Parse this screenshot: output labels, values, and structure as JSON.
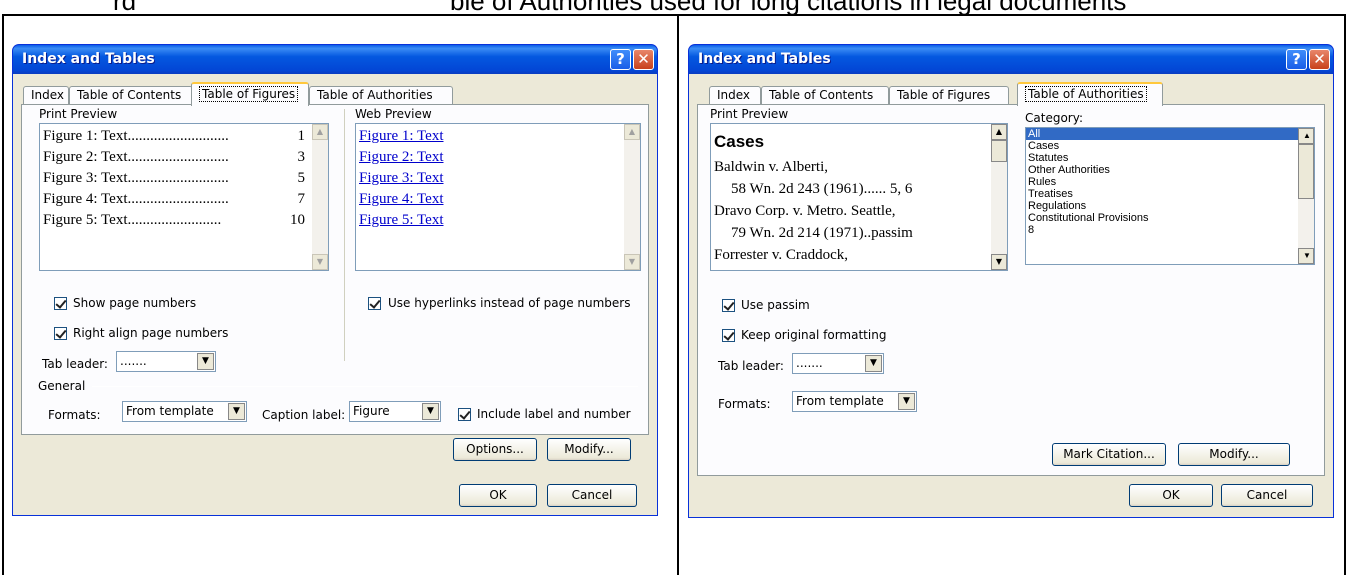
{
  "top_caption": [
    "rd",
    "ble of Authorities used for long citations in legal documents"
  ],
  "left_dialog": {
    "title": "Index and Tables",
    "help_glyph": "?",
    "close_glyph": "✕",
    "tabs": [
      "Index",
      "Table of Contents",
      "Table of Figures",
      "Table of Authorities"
    ],
    "active_tab": "Table of Figures",
    "print_preview_label": "Print Preview",
    "print_preview_rows": [
      {
        "text": "Figure 1: Text",
        "dots": "...........................",
        "page": "1"
      },
      {
        "text": "Figure 2: Text",
        "dots": "...........................",
        "page": "3"
      },
      {
        "text": "Figure 3: Text",
        "dots": "...........................",
        "page": "5"
      },
      {
        "text": "Figure 4: Text",
        "dots": "...........................",
        "page": "7"
      },
      {
        "text": "Figure 5: Text",
        "dots": ".........................",
        "page": "10"
      }
    ],
    "web_preview_label": "Web Preview",
    "web_preview_links": [
      "Figure 1: Text",
      "Figure 2: Text",
      "Figure 3: Text",
      "Figure 4: Text",
      "Figure 5: Text"
    ],
    "show_page_numbers": "Show page numbers",
    "right_align": "Right align page numbers",
    "use_hyperlinks": "Use hyperlinks instead of page numbers",
    "tab_leader_label": "Tab leader:",
    "tab_leader_value": ".......",
    "general_label": "General",
    "formats_label": "Formats:",
    "formats_value": "From template",
    "caption_label": "Caption label:",
    "caption_value": "Figure",
    "include_label": "Include label and number",
    "options_button": "Options...",
    "modify_button": "Modify...",
    "ok_button": "OK",
    "cancel_button": "Cancel"
  },
  "right_dialog": {
    "title": "Index and Tables",
    "help_glyph": "?",
    "close_glyph": "✕",
    "tabs": [
      "Index",
      "Table of Contents",
      "Table of Figures",
      "Table of Authorities"
    ],
    "active_tab": "Table of Authorities",
    "print_preview_label": "Print Preview",
    "preview_heading": "Cases",
    "preview_lines": [
      "Baldwin v. Alberti,",
      "58 Wn. 2d 243 (1961)...... 5, 6",
      "Dravo Corp. v. Metro. Seattle,",
      "79 Wn. 2d 214 (1971)..passim",
      "Forrester v. Craddock,"
    ],
    "category_label": "Category:",
    "categories": [
      "All",
      "Cases",
      "Statutes",
      "Other Authorities",
      "Rules",
      "Treatises",
      "Regulations",
      "Constitutional Provisions",
      "8"
    ],
    "selected_category": "All",
    "use_passim": "Use passim",
    "keep_formatting": "Keep original formatting",
    "tab_leader_label": "Tab leader:",
    "tab_leader_value": ".......",
    "formats_label": "Formats:",
    "formats_value": "From template",
    "mark_citation_button": "Mark Citation...",
    "modify_button": "Modify...",
    "ok_button": "OK",
    "cancel_button": "Cancel"
  },
  "colors": {
    "dialog_bg": "#ece9d8",
    "titlebar": "#0458e0",
    "selection": "#316ac5",
    "link": "#0000cc"
  }
}
